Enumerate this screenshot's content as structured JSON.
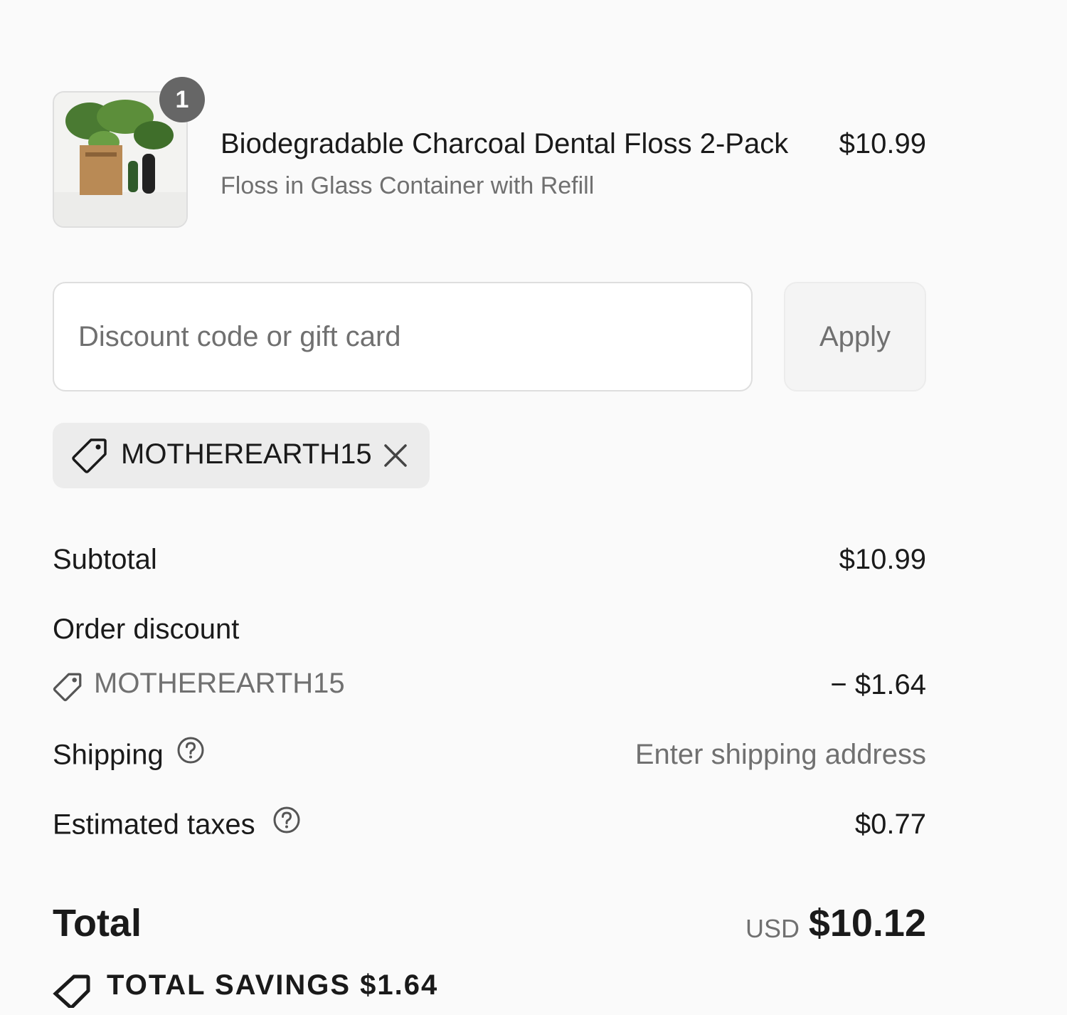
{
  "product": {
    "quantity": "1",
    "title": "Biodegradable Charcoal Dental Floss 2-Pack",
    "variant": "Floss in Glass Container with Refill",
    "price": "$10.99"
  },
  "discount": {
    "placeholder": "Discount code or gift card",
    "apply_label": "Apply",
    "applied_code": "MOTHEREARTH15"
  },
  "summary": {
    "subtotal_label": "Subtotal",
    "subtotal_value": "$10.99",
    "order_discount_label": "Order discount",
    "order_discount_code": "MOTHEREARTH15",
    "order_discount_value": "− $1.64",
    "shipping_label": "Shipping",
    "shipping_value": "Enter shipping address",
    "taxes_label": "Estimated taxes",
    "taxes_value": "$0.77",
    "total_label": "Total",
    "currency": "USD",
    "total_value": "$10.12",
    "savings_text": "TOTAL SAVINGS $1.64"
  },
  "colors": {
    "background": "#fafafa",
    "text": "#1a1a1a",
    "muted": "#707070",
    "badge": "#666666"
  }
}
